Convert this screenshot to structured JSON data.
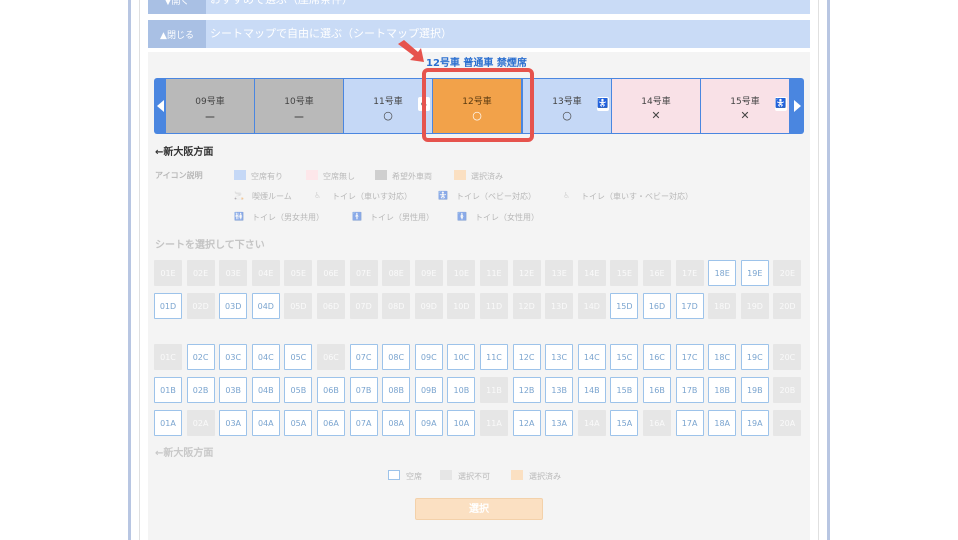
{
  "top_bar": {
    "button": "▼開く",
    "text": "おすすめで選ぶ（座席条件）"
  },
  "section_bar": {
    "button": "▲閉じる",
    "text": "シートマップで自由に選ぶ（シートマップ選択）"
  },
  "selected_car_title": "12号車 普通車 禁煙席",
  "cars": [
    {
      "name": "09号車",
      "mark": "ー",
      "state": "unavailable"
    },
    {
      "name": "10号車",
      "mark": "ー",
      "state": "unavailable"
    },
    {
      "name": "11号車",
      "mark": "○",
      "state": "available",
      "icon": "♿"
    },
    {
      "name": "12号車",
      "mark": "○",
      "state": "selected"
    },
    {
      "name": "13号車",
      "mark": "○",
      "state": "available",
      "icon": "🚼"
    },
    {
      "name": "14号車",
      "mark": "✕",
      "state": "full"
    },
    {
      "name": "15号車",
      "mark": "✕",
      "state": "full",
      "icon": "🚼"
    }
  ],
  "direction_label": "←新大阪方面",
  "legend": {
    "title": "アイコン説明",
    "items": [
      "空席有り",
      "空席無し",
      "希望外車両",
      "選択済み"
    ],
    "facilities": [
      "喫煙ルーム",
      "トイレ（車いす対応）",
      "トイレ（ベビー対応）",
      "トイレ（車いす・ベビー対応）",
      "トイレ（男女共用）",
      "トイレ（男性用）",
      "トイレ（女性用）"
    ]
  },
  "seat_prompt": "シートを選択して下さい",
  "columns": [
    "01",
    "02",
    "03",
    "04",
    "05",
    "06",
    "07",
    "08",
    "09",
    "10",
    "11",
    "12",
    "13",
    "14",
    "15",
    "16",
    "17",
    "18",
    "19",
    "20"
  ],
  "rows": {
    "E": "nnnnnnnnnnnnnnnnnyyn",
    "D": "ynyynnnnnnnnnnyyynnn",
    "C": "nyyyynyyyyyyyyyyyyyn",
    "B": "yyyyyyyyyynyyyyyyyyn",
    "A": "ynyyyyyyyynyynynyyyn"
  },
  "key": {
    "available": "空席",
    "unavailable": "選択不可",
    "selected": "選択済み"
  },
  "select_button": "選択",
  "colors": {
    "accent": "#4a86e0",
    "selected": "#f2a24a",
    "highlight": "#e6534d",
    "full": "#f9e1e7"
  }
}
